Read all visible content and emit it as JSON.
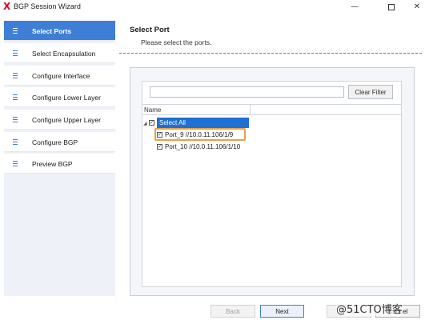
{
  "window": {
    "title": "BGP Session Wizard",
    "logo_glyph": "X",
    "minimize_glyph": "—",
    "close_glyph": "✕"
  },
  "sidebar": {
    "items": [
      {
        "label": "Select Ports",
        "active": true
      },
      {
        "label": "Select Encapsulation",
        "active": false
      },
      {
        "label": "Configure Interface",
        "active": false
      },
      {
        "label": "Configure Lower Layer",
        "active": false
      },
      {
        "label": "Configure Upper Layer",
        "active": false
      },
      {
        "label": "Configure BGP",
        "active": false
      },
      {
        "label": "Preview BGP",
        "active": false
      }
    ],
    "item_icon": "list-icon"
  },
  "main": {
    "title": "Select Port",
    "subtitle": "Please select the ports.",
    "filter": {
      "value": "",
      "placeholder": ""
    },
    "clear_filter_label": "Clear Filter",
    "grid": {
      "columns": [
        "Name"
      ],
      "select_all_label": "Select All",
      "select_all_checked": true,
      "expander_glyph": "◢",
      "rows": [
        {
          "label": "Port_9 //10.0.11.106/1/9",
          "checked": true
        },
        {
          "label": "Port_10 //10.0.11.106/1/10",
          "checked": true
        }
      ],
      "check_glyph": "✓"
    }
  },
  "footer": {
    "back_label": "Back",
    "next_label": "Next",
    "finish_label": "Finish",
    "cancel_label": "Cancel"
  },
  "watermark": "@51CTO博客",
  "colors": {
    "accent": "#3d7fd6",
    "selection": "#1f70d4",
    "highlight": "#e8a04c",
    "logo": "#c8102e"
  }
}
